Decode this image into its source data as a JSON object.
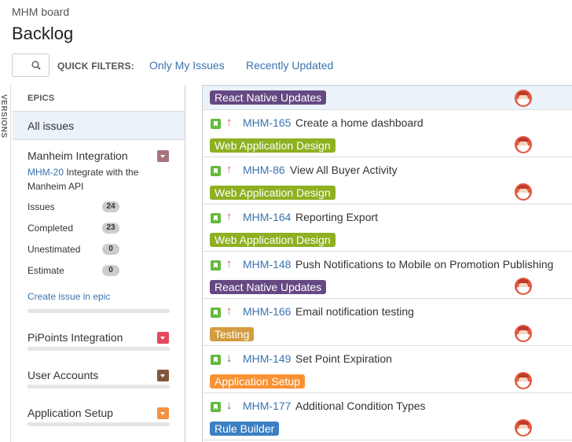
{
  "header": {
    "board_name": "MHM board",
    "title": "Backlog"
  },
  "quick_filters": {
    "label": "QUICK FILTERS:",
    "items": [
      "Only My Issues",
      "Recently Updated"
    ]
  },
  "versions_tab": {
    "label": "VERSIONS"
  },
  "epics": {
    "header": "EPICS",
    "all_issues": "All issues",
    "expanded": {
      "name": "Manheim Integration",
      "color": "#a9737d",
      "key": "MHM-20",
      "description": " Integrate with the Manheim API",
      "stats": [
        {
          "label": "Issues",
          "value": "24"
        },
        {
          "label": "Completed",
          "value": "23"
        },
        {
          "label": "Unestimated",
          "value": "0"
        },
        {
          "label": "Estimate",
          "value": "0"
        }
      ],
      "create_link": "Create issue in epic"
    },
    "others": [
      {
        "name": "PiPoints Integration",
        "color": "#e5495c"
      },
      {
        "name": "User Accounts",
        "color": "#80573d"
      },
      {
        "name": "Application Setup",
        "color": "#f59240"
      }
    ]
  },
  "epic_colors": {
    "React Native Updates": "#654982",
    "Web Application Design": "#8eb021",
    "Testing": "#d39c3f",
    "Application Setup": "#f79232",
    "Rule Builder": "#3b7fc4"
  },
  "issues": [
    {
      "key": "",
      "summary": "",
      "priority": "",
      "epic": "React Native Updates"
    },
    {
      "key": "MHM-165",
      "summary": "Create a home dashboard",
      "priority": "up",
      "epic": "Web Application Design"
    },
    {
      "key": "MHM-86",
      "summary": "View All Buyer Activity",
      "priority": "up",
      "epic": "Web Application Design"
    },
    {
      "key": "MHM-164",
      "summary": "Reporting Export",
      "priority": "up",
      "epic": "Web Application Design"
    },
    {
      "key": "MHM-148",
      "summary": "Push Notifications to Mobile on Promotion Publishing",
      "priority": "up",
      "epic": "React Native Updates"
    },
    {
      "key": "MHM-166",
      "summary": "Email notification testing",
      "priority": "up",
      "epic": "Testing"
    },
    {
      "key": "MHM-149",
      "summary": "Set Point Expiration",
      "priority": "down",
      "epic": "Application Setup"
    },
    {
      "key": "MHM-177",
      "summary": "Additional Condition Types",
      "priority": "down",
      "epic": "Rule Builder"
    }
  ],
  "priority_colors": {
    "up": "#f15c3c",
    "down": "#3b8c3b"
  }
}
